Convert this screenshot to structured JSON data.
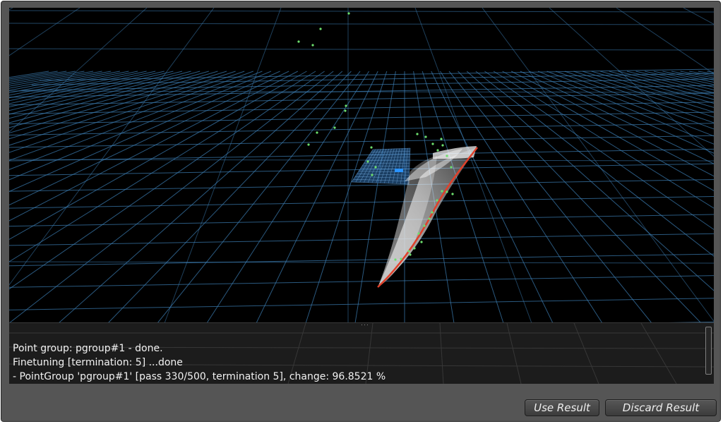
{
  "viewport": {
    "background": "#000000",
    "grid_color": "#3d7fb5",
    "point_color": "#6ee06e",
    "surface_color": "#f2f2f2",
    "edge_color": "#e0402a",
    "selection_patch_color": "#2f6fb0"
  },
  "log": {
    "lines": [
      "Point group: pgroup#1 -  done.",
      "Finetuning [termination: 5] ...done",
      "- PointGroup 'pgroup#1'  [pass 330/500, termination 5], change: 96.8521 %"
    ]
  },
  "buttons": {
    "use_result": "Use Result",
    "discard_result": "Discard Result"
  }
}
